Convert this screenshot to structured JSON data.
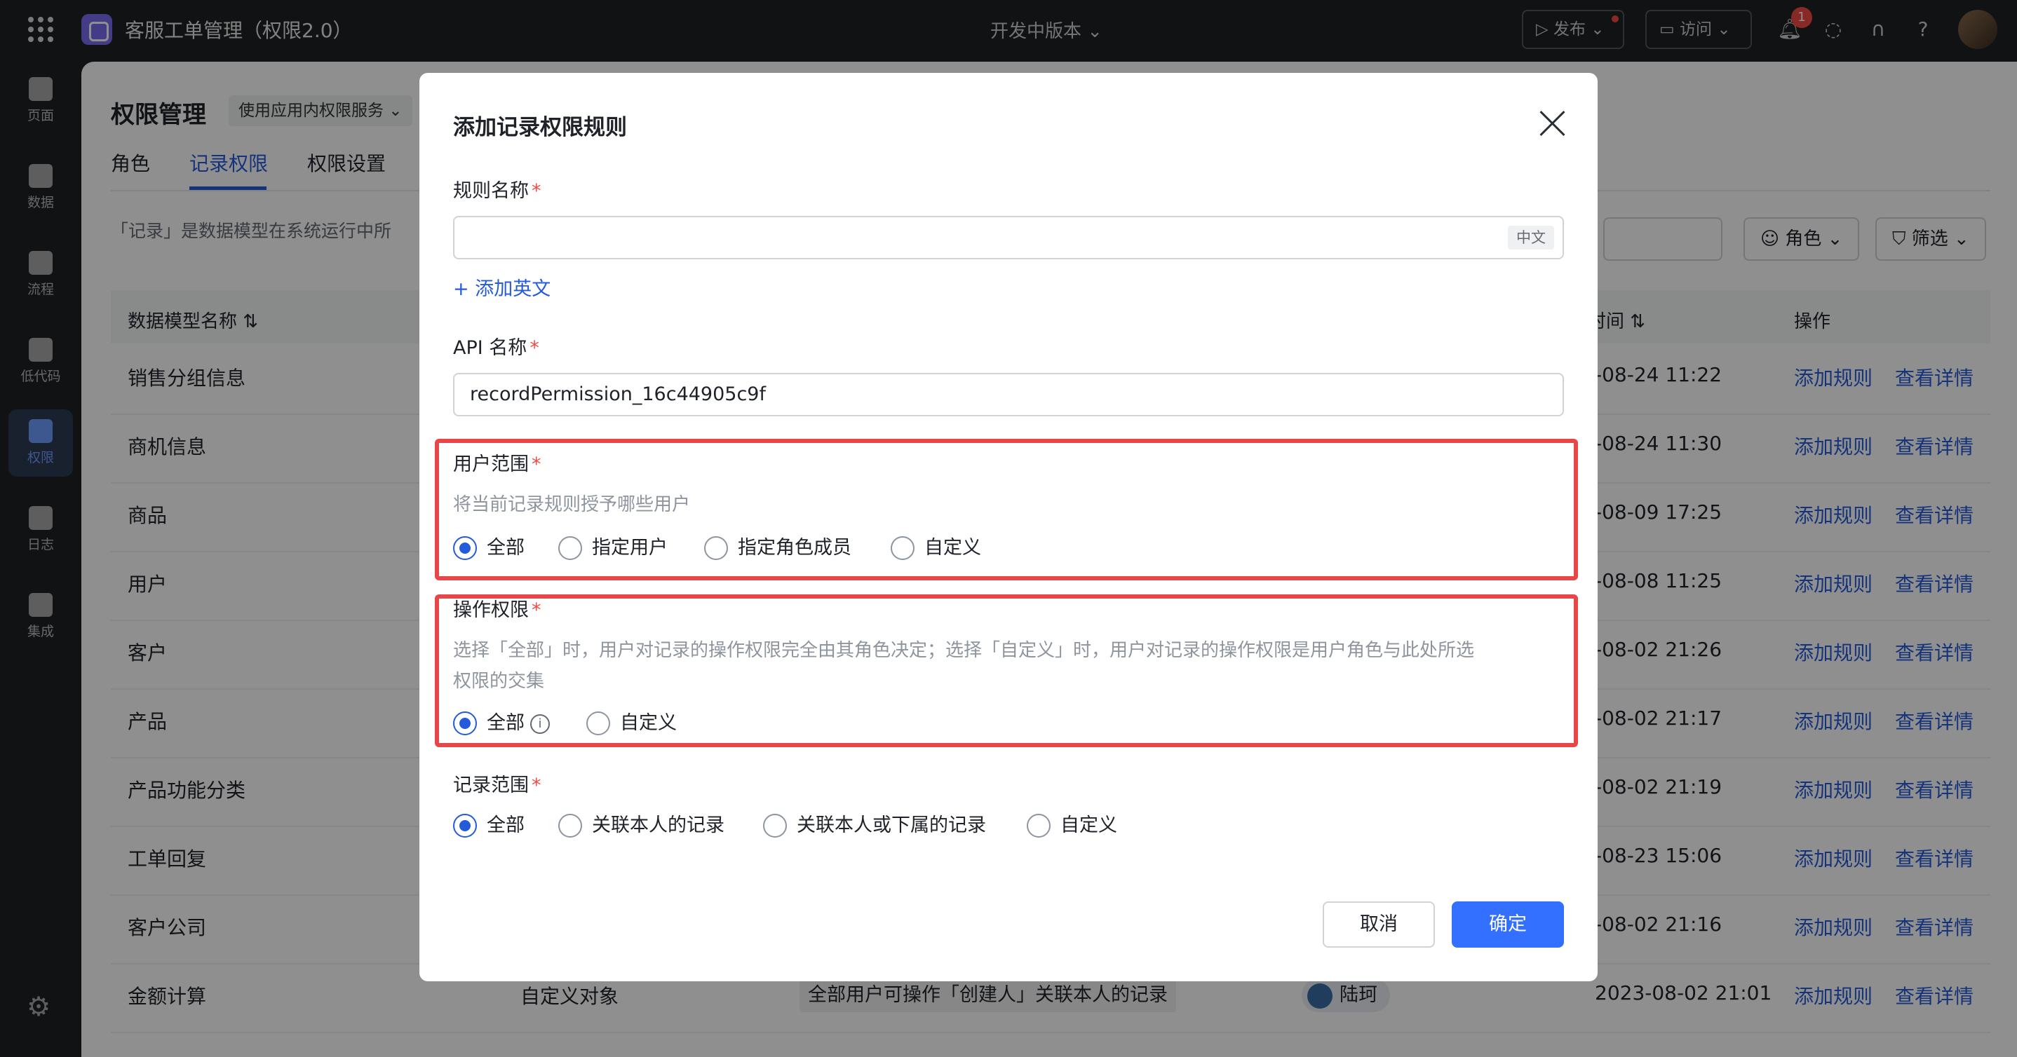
{
  "topbar": {
    "app_title": "客服工单管理（权限2.0）",
    "version": "开发中版本",
    "publish": "发布",
    "visit": "访问",
    "notifications": "1"
  },
  "sidenav": [
    {
      "label": "页面",
      "icon": "page-icon"
    },
    {
      "label": "数据",
      "icon": "database-icon"
    },
    {
      "label": "流程",
      "icon": "flow-icon"
    },
    {
      "label": "低代码",
      "icon": "code-icon"
    },
    {
      "label": "权限",
      "icon": "permission-icon",
      "active": true
    },
    {
      "label": "日志",
      "icon": "log-icon"
    },
    {
      "label": "集成",
      "icon": "key-icon"
    }
  ],
  "page": {
    "title": "权限管理",
    "service": "使用应用内权限服务",
    "tabs": [
      "角色",
      "记录权限",
      "权限设置"
    ],
    "active_tab": "记录权限",
    "description": "「记录」是数据模型在系统运行中所",
    "role_btn": "角色",
    "filter_btn": "筛选"
  },
  "table": {
    "headers": {
      "name": "数据模型名称",
      "time": "时间",
      "ops": "操作"
    },
    "rows": [
      {
        "name": "销售分组信息",
        "time": "-08-24 11:22"
      },
      {
        "name": "商机信息",
        "time": "-08-24 11:30"
      },
      {
        "name": "商品",
        "time": "-08-09 17:25"
      },
      {
        "name": "用户",
        "time": "-08-08 11:25"
      },
      {
        "name": "客户",
        "time": "-08-02 21:26"
      },
      {
        "name": "产品",
        "time": "-08-02 21:17"
      },
      {
        "name": "产品功能分类",
        "time": "-08-02 21:19"
      },
      {
        "name": "工单回复",
        "time": "-08-23 15:06"
      },
      {
        "name": "客户公司",
        "time": "-08-02 21:16"
      },
      {
        "name": "金额计算",
        "time": "2023-08-02 21:01",
        "type": "自定义对象",
        "desc": "全部用户可操作「创建人」关联本人的记录",
        "user": "陆珂"
      }
    ],
    "add_rule": "添加规则",
    "view_detail": "查看详情"
  },
  "modal": {
    "title": "添加记录权限规则",
    "rule_name_label": "规则名称",
    "rule_name_value": "",
    "lang_tag": "中文",
    "add_english": "+ 添加英文",
    "api_label": "API 名称",
    "api_value": "recordPermission_16c44905c9f",
    "user_scope_label": "用户范围",
    "user_scope_hint": "将当前记录规则授予哪些用户",
    "user_scope_options": [
      "全部",
      "指定用户",
      "指定角色成员",
      "自定义"
    ],
    "op_perm_label": "操作权限",
    "op_perm_hint_1": "选择「全部」时，用户对记录的操作权限完全由其角色决定；选择「自定义」时，用户对记录的操作权限是用户角色与此处所选",
    "op_perm_hint_2": "权限的交集",
    "op_perm_options": [
      "全部",
      "自定义"
    ],
    "record_scope_label": "记录范围",
    "record_scope_options": [
      "全部",
      "关联本人的记录",
      "关联本人或下属的记录",
      "自定义"
    ],
    "cancel": "取消",
    "ok": "确定",
    "required_mark": "*"
  },
  "colors": {
    "accent": "#3370ff",
    "link": "#245bdb",
    "highlight_border": "#e8474a",
    "required": "#f54a45"
  }
}
